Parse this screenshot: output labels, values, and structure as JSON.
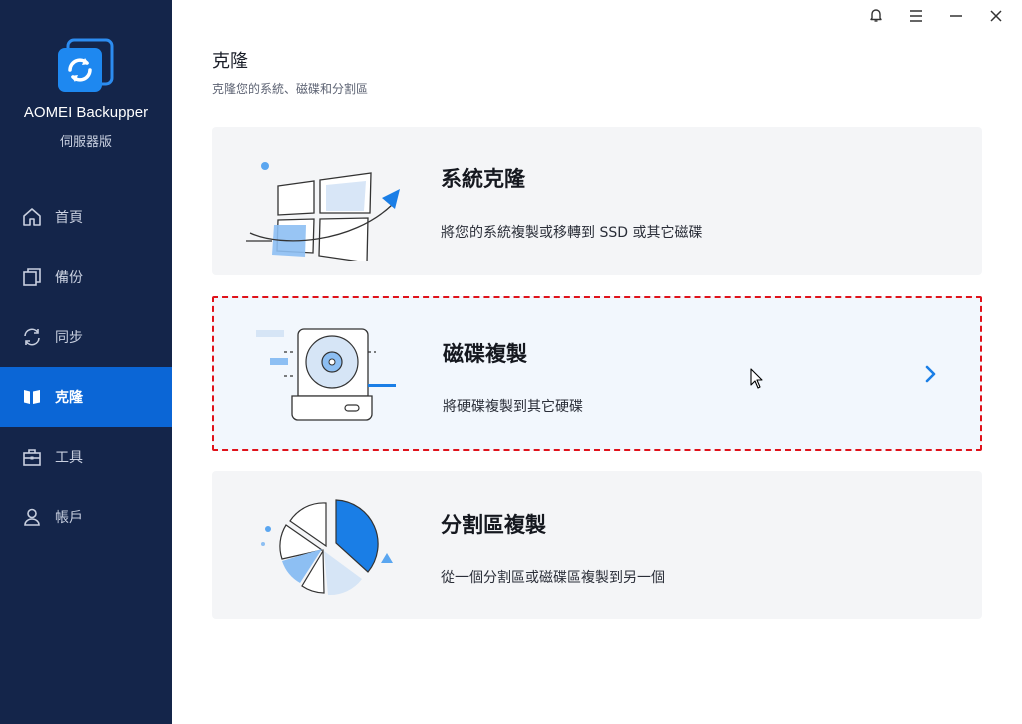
{
  "app": {
    "name": "AOMEI Backupper",
    "edition": "伺服器版"
  },
  "sidebar": {
    "items": [
      {
        "label": "首頁",
        "icon": "home-icon",
        "active": false
      },
      {
        "label": "備份",
        "icon": "backup-icon",
        "active": false
      },
      {
        "label": "同步",
        "icon": "sync-icon",
        "active": false
      },
      {
        "label": "克隆",
        "icon": "clone-icon",
        "active": true
      },
      {
        "label": "工具",
        "icon": "tools-icon",
        "active": false
      },
      {
        "label": "帳戶",
        "icon": "account-icon",
        "active": false
      }
    ]
  },
  "window_controls": [
    "bell-icon",
    "menu-icon",
    "minimize-icon",
    "close-icon"
  ],
  "main": {
    "title": "克隆",
    "subtitle": "克隆您的系統、磁碟和分割區",
    "cards": [
      {
        "title": "系統克隆",
        "description": "將您的系統複製或移轉到 SSD 或其它磁碟",
        "icon": "windows-system-icon"
      },
      {
        "title": "磁碟複製",
        "description": "將硬碟複製到其它硬碟",
        "icon": "hard-disk-icon",
        "highlighted": true
      },
      {
        "title": "分割區複製",
        "description": "從一個分割區或磁碟區複製到另一個",
        "icon": "partition-pie-icon"
      }
    ]
  },
  "colors": {
    "sidebar_bg": "#14254a",
    "accent": "#0b66d6",
    "highlight_border": "#e0121a",
    "card_bg": "#f4f5f7"
  }
}
